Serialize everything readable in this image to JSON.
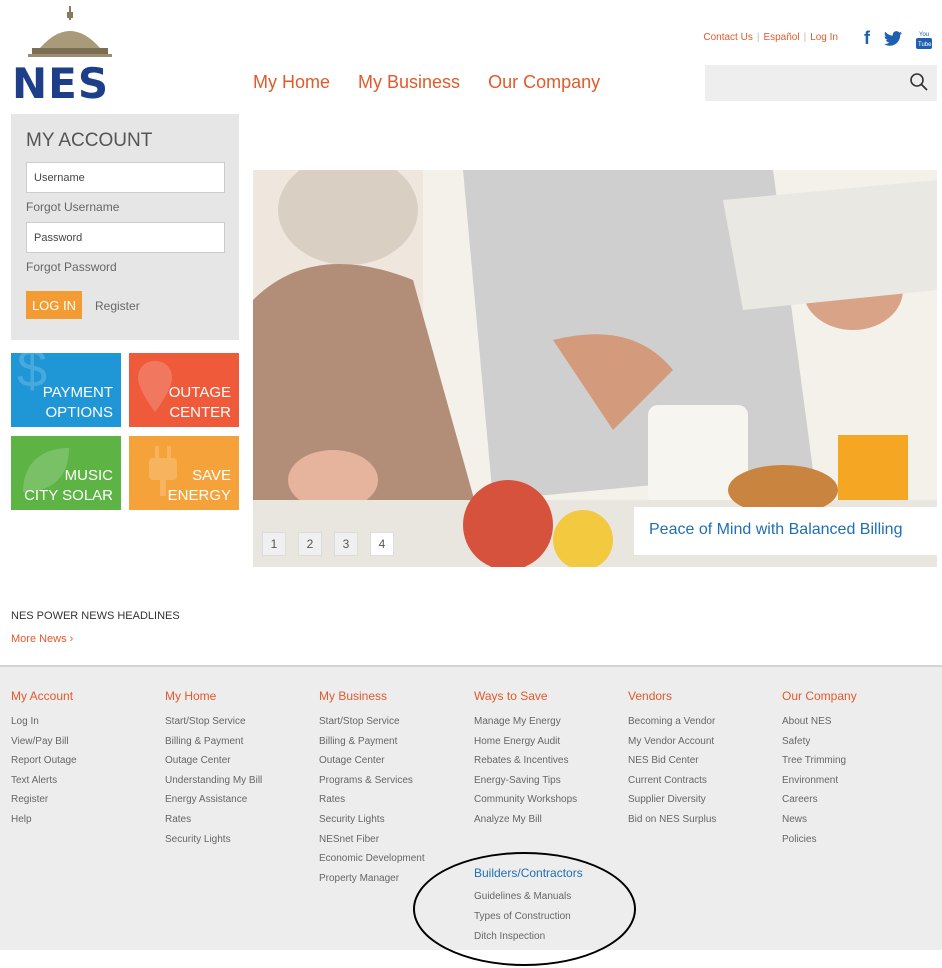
{
  "header": {
    "logo_text": "NES",
    "nav": [
      "My Home",
      "My Business",
      "Our Company"
    ],
    "util_links": [
      "Contact Us",
      "Español",
      "Log In"
    ],
    "social": [
      "f",
      "t",
      "You Tube"
    ]
  },
  "account": {
    "title": "MY ACCOUNT",
    "username_value": "Username",
    "forgot_username": "Forgot Username",
    "password_value": "Password",
    "forgot_password": "Forgot Password",
    "login_label": "LOG IN",
    "register_label": "Register"
  },
  "tiles": [
    {
      "line1": "PAYMENT",
      "line2": "OPTIONS",
      "color": "#1f96d6"
    },
    {
      "line1": "OUTAGE",
      "line2": "CENTER",
      "color": "#ef5a3b"
    },
    {
      "line1": "MUSIC",
      "line2": "CITY SOLAR",
      "color": "#5db344"
    },
    {
      "line1": "SAVE",
      "line2": "ENERGY",
      "color": "#f6a23a"
    }
  ],
  "hero": {
    "caption": "Peace of Mind with Balanced Billing",
    "slides": [
      "1",
      "2",
      "3",
      "4"
    ],
    "active_slide": "4"
  },
  "news": {
    "title": "NES POWER NEWS HEADLINES",
    "more": "More News ›"
  },
  "footer": {
    "columns": [
      {
        "head": "My Account",
        "items": [
          "Log In",
          "View/Pay Bill",
          "Report Outage",
          "Text Alerts",
          "Register",
          "Help"
        ]
      },
      {
        "head": "My Home",
        "items": [
          "Start/Stop Service",
          "Billing & Payment",
          "Outage Center",
          "Understanding My Bill",
          "Energy Assistance",
          "Rates",
          "Security Lights"
        ]
      },
      {
        "head": "My Business",
        "items": [
          "Start/Stop Service",
          "Billing & Payment",
          "Outage Center",
          "Programs & Services",
          "Rates",
          "Security Lights",
          "NESnet Fiber",
          "Economic Development",
          "Property Manager"
        ]
      },
      {
        "head": "Ways to Save",
        "items": [
          "Manage My Energy",
          "Home Energy Audit",
          "Rebates & Incentives",
          "Energy-Saving Tips",
          "Community Workshops",
          "Analyze My Bill"
        ]
      },
      {
        "head": "Vendors",
        "items": [
          "Becoming a Vendor",
          "My Vendor Account",
          "NES Bid Center",
          "Current Contracts",
          "Supplier Diversity",
          "Bid on NES Surplus"
        ]
      },
      {
        "head": "Our Company",
        "items": [
          "About NES",
          "Safety",
          "Tree Trimming",
          "Environment",
          "Careers",
          "News",
          "Policies"
        ]
      }
    ],
    "builders": {
      "head": "Builders/Contractors",
      "items": [
        "Guidelines & Manuals",
        "Types of Construction",
        "Ditch Inspection"
      ]
    }
  }
}
